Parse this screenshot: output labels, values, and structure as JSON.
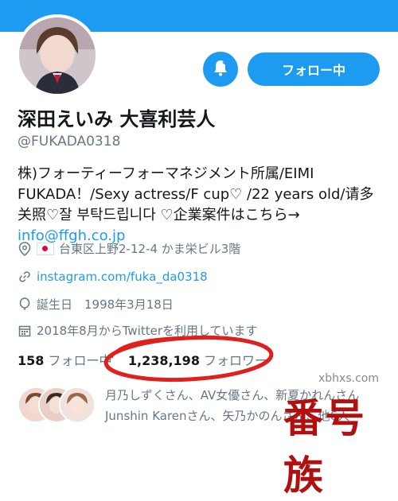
{
  "profile": {
    "display_name": "深田えいみ 大喜利芸人",
    "handle": "@FUKADA0318",
    "bio_text": "株)フォーティーフォーマネジメント所属/EIMI FUKADA！/Sexy actress/F cup♡ /22 years old/请多关照♡잘 부탁드립니다 ♡企業案件はこちら→ ",
    "bio_email": "info@ffgh.co.jp",
    "location": "台東区上野2-12-4 かま栄ビル3階",
    "website": "instagram.com/fuka_da0318",
    "birthday": "誕生日　1998年3月18日",
    "joined": "2018年8月からTwitterを利用しています"
  },
  "actions": {
    "follow_label": "フォロー中"
  },
  "stats": {
    "following_count": "158",
    "following_label": "フォロー中",
    "followers_count": "1,238,198",
    "followers_label": "フォロワー"
  },
  "followed_by": {
    "line1": "月乃しずくさん、AV女優さん、新夏かれんさん",
    "line2": "Junshin Karenさん、矢乃かのんさん、他6人"
  },
  "watermark": {
    "site": "xbhxs.com",
    "brand": "番号族"
  },
  "colors": {
    "accent": "#1d9bf0",
    "secondary_text": "#657786",
    "annotation": "#e0201e"
  }
}
